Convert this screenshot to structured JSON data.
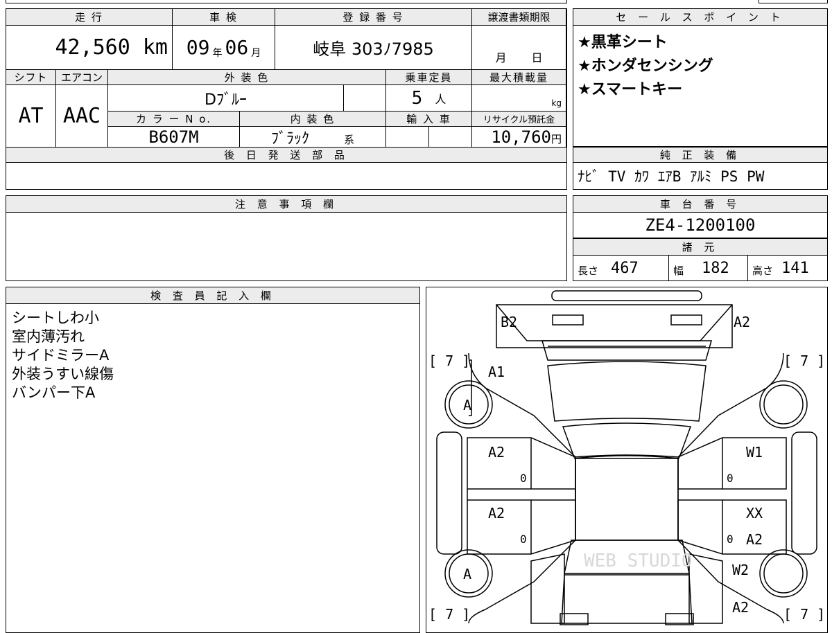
{
  "main": {
    "h_mileage": "走 行",
    "mileage_value": "42,560 km",
    "h_shaken": "車 検",
    "shaken_year": "09",
    "shaken_year_unit": "年",
    "shaken_month": "06",
    "shaken_month_unit": "月",
    "h_reg": "登 録 番 号",
    "reg_value": "岐阜 303ﾉ7985",
    "h_transfer": "譲渡書類期限",
    "transfer_month_unit": "月",
    "transfer_day_unit": "日",
    "h_shift": "シフト",
    "shift_value": "AT",
    "h_aircon": "エアコン",
    "aircon_value": "AAC",
    "h_exterior": "外 装 色",
    "exterior_value": "Dﾌﾞﾙｰ",
    "h_capacity": "乗車定員",
    "capacity_value": "5",
    "capacity_unit": "人",
    "h_maxload": "最大積載量",
    "maxload_unit": "kg",
    "h_colorno": "カ ラ ー N o.",
    "colorno_value": "B607M",
    "h_interior": "内 装 色",
    "interior_value": "ﾌﾞﾗｯｸ",
    "interior_suffix": "系",
    "h_import": "輸 入 車",
    "h_recycle": "リサイクル預託金",
    "recycle_value": "10,760",
    "recycle_unit": "円",
    "h_later": "後 日 発 送 部 品"
  },
  "sales": {
    "header": "セ ー ル ス ポ イ ン ト",
    "points": [
      "★黒革シート",
      "★ホンダセンシング",
      "★スマートキー"
    ]
  },
  "equipment": {
    "header": "純 正 装 備",
    "value": "ﾅﾋﾞ TV ｶﾜ ｴｱB ｱﾙﾐ PS PW"
  },
  "notes": {
    "header": "注 意 事 項 欄"
  },
  "chassis": {
    "header": "車 台 番 号",
    "value": "ZE4-1200100"
  },
  "specs": {
    "header": "諸 元",
    "length_label": "長さ",
    "length_value": "467",
    "width_label": "幅",
    "width_value": "182",
    "height_label": "高さ",
    "height_value": "141"
  },
  "inspector": {
    "header": "検 査 員 記 入 欄",
    "lines": [
      "シートしわ小",
      "室内薄汚れ",
      "サイドミラーA",
      "外装うすい線傷",
      "バンパー下A"
    ]
  },
  "diagram": {
    "marks": {
      "b2": "B2",
      "a2_top": "A2",
      "bracket_tl": "[ 7 ]",
      "bracket_tr": "[ 7 ]",
      "bracket_bl": "[ 7 ]",
      "bracket_br": "[ 7 ]",
      "a1": "A1",
      "tire_fl": "A",
      "tire_rl": "A",
      "a2_ld1": "A2",
      "zero_ld1": "0",
      "a2_ld2": "A2",
      "zero_ld2": "0",
      "w1": "W1",
      "zero_rd1": "0",
      "xx": "XX",
      "zero_rd2": "0",
      "a2_rd2": "A2",
      "w2": "W2",
      "a2_rr": "A2"
    },
    "watermark": "WEB STUDIO"
  }
}
